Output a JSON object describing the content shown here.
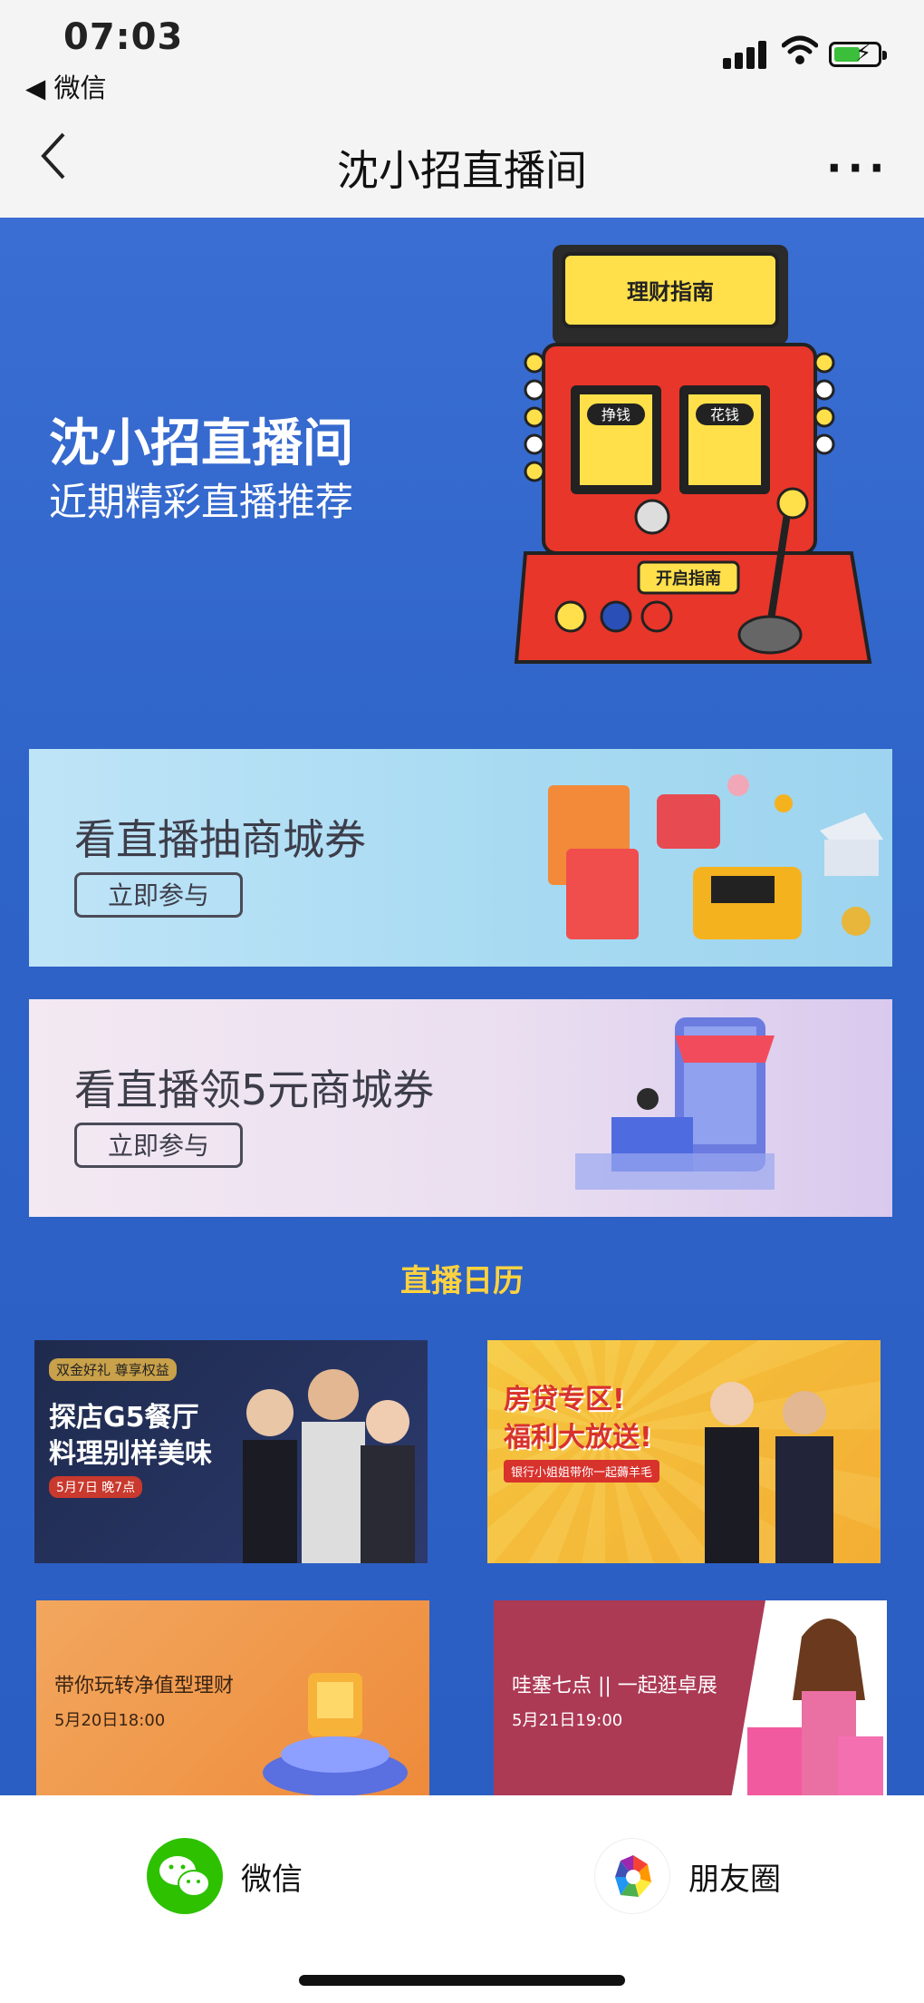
{
  "status_bar": {
    "time": "07:03",
    "back_app": "◀ 微信"
  },
  "nav": {
    "back_icon": "chevron-left",
    "title": "沈小招直播间",
    "more": "···"
  },
  "hero": {
    "title": "沈小招直播间",
    "subtitle": "近期精彩直播推荐",
    "machine_screen": "理财指南",
    "machine_left_label": "挣钱",
    "machine_right_label": "花钱",
    "machine_button": "开启指南"
  },
  "banners": [
    {
      "title": "看直播抽商城券",
      "button": "立即参与"
    },
    {
      "title": "看直播领5元商城券",
      "button": "立即参与"
    }
  ],
  "calendar": {
    "title": "直播日历",
    "cards": [
      {
        "line1": "探店G5餐厅",
        "line2": "料理别样美味",
        "tag": "双金好礼 尊享权益",
        "date": "5月7日 晚7点"
      },
      {
        "line1": "房贷专区!",
        "line2": "福利大放送!",
        "tag": "银行小姐姐带你一起薅羊毛"
      },
      {
        "line1": "带你玩转净值型理财",
        "date": "5月20日18:00"
      },
      {
        "line1": "哇塞七点 || 一起逛卓展",
        "date": "5月21日19:00"
      }
    ]
  },
  "share": {
    "wechat": "微信",
    "moments": "朋友圈"
  },
  "colors": {
    "page_blue": "#2f62c8",
    "calendar_title": "#ffd23f",
    "wechat_green": "#2dc100"
  }
}
